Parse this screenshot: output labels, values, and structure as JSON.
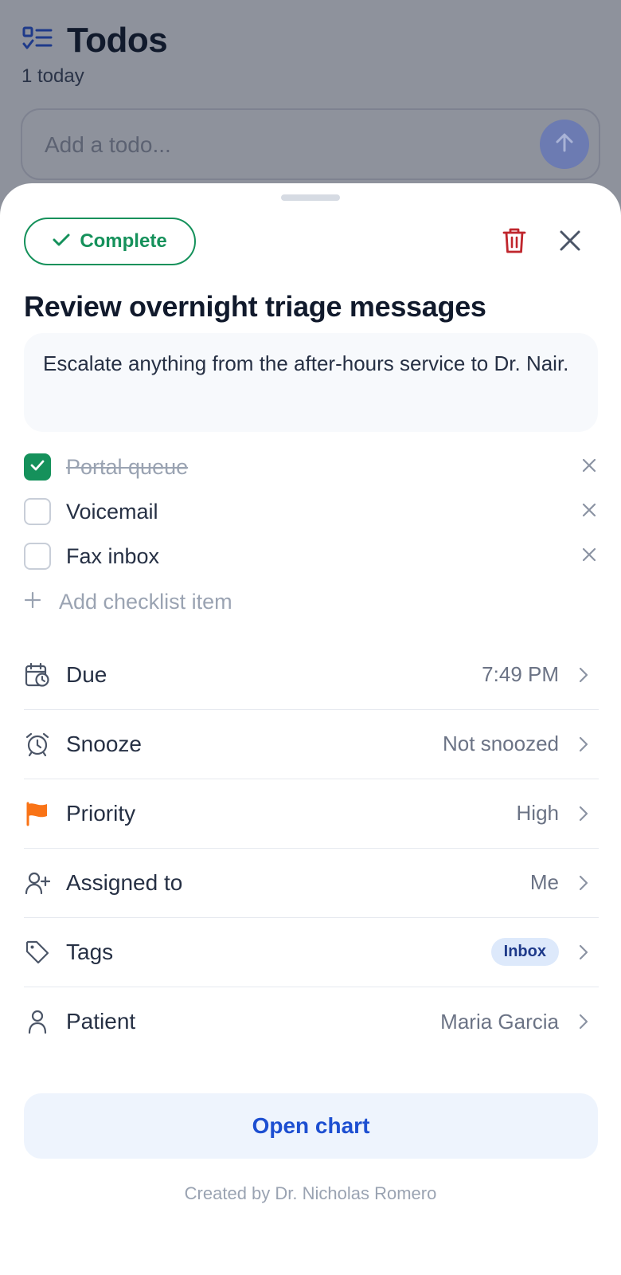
{
  "background": {
    "title": "Todos",
    "subtitle": "1 today",
    "input_placeholder": "Add a todo..."
  },
  "sheet": {
    "complete_label": "Complete",
    "title": "Review overnight triage messages",
    "description": "Escalate anything from the after-hours service to Dr. Nair.",
    "checklist": [
      {
        "label": "Portal queue",
        "checked": true
      },
      {
        "label": "Voicemail",
        "checked": false
      },
      {
        "label": "Fax inbox",
        "checked": false
      }
    ],
    "add_checklist_label": "Add checklist item",
    "rows": {
      "due": {
        "label": "Due",
        "value": "7:49 PM"
      },
      "snooze": {
        "label": "Snooze",
        "value": "Not snoozed"
      },
      "priority": {
        "label": "Priority",
        "value": "High"
      },
      "assigned": {
        "label": "Assigned to",
        "value": "Me"
      },
      "tags": {
        "label": "Tags",
        "value": "Inbox"
      },
      "patient": {
        "label": "Patient",
        "value": "Maria Garcia"
      }
    },
    "open_chart_label": "Open chart",
    "created_by": "Created by Dr. Nicholas Romero"
  },
  "colors": {
    "accent_green": "#15915b",
    "accent_blue": "#1d4fd1",
    "danger_red": "#c0262d",
    "priority_orange": "#f97316"
  }
}
